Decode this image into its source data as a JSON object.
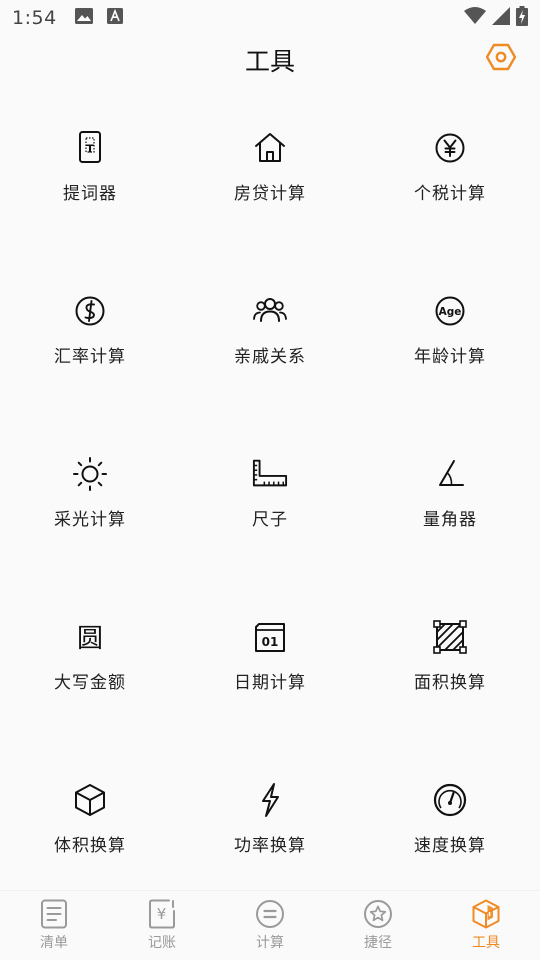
{
  "status_bar": {
    "time": "1:54",
    "left_icons": [
      "image-notification-icon",
      "font-notification-icon"
    ],
    "right_icons": [
      "wifi-icon",
      "cell-signal-icon",
      "battery-charging-icon"
    ]
  },
  "header": {
    "title": "工具",
    "settings_icon": "hexagon-settings-icon"
  },
  "tools": [
    {
      "label": "提词器",
      "icon": "teleprompter-icon"
    },
    {
      "label": "房贷计算",
      "icon": "house-icon"
    },
    {
      "label": "个税计算",
      "icon": "yen-circle-icon"
    },
    {
      "label": "汇率计算",
      "icon": "currency-exchange-icon"
    },
    {
      "label": "亲戚关系",
      "icon": "people-icon"
    },
    {
      "label": "年龄计算",
      "icon": "age-icon"
    },
    {
      "label": "采光计算",
      "icon": "sun-icon"
    },
    {
      "label": "尺子",
      "icon": "ruler-icon"
    },
    {
      "label": "量角器",
      "icon": "protractor-icon"
    },
    {
      "label": "大写金额",
      "icon": "yuan-character-icon"
    },
    {
      "label": "日期计算",
      "icon": "calendar-icon"
    },
    {
      "label": "面积换算",
      "icon": "area-icon"
    },
    {
      "label": "体积换算",
      "icon": "cube-icon"
    },
    {
      "label": "功率换算",
      "icon": "lightning-icon"
    },
    {
      "label": "速度换算",
      "icon": "speedometer-icon"
    }
  ],
  "tool_icon_texts": {
    "teleprompter": "T",
    "age": "Age",
    "yuan": "圆",
    "calendar": "01"
  },
  "bottom_nav": {
    "items": [
      {
        "label": "清单",
        "icon": "list-icon",
        "active": false
      },
      {
        "label": "记账",
        "icon": "ledger-yen-icon",
        "active": false
      },
      {
        "label": "计算",
        "icon": "calculator-equals-icon",
        "active": false
      },
      {
        "label": "捷径",
        "icon": "star-circle-icon",
        "active": false
      },
      {
        "label": "工具",
        "icon": "toolbox-icon",
        "active": true
      }
    ],
    "yen_glyph": "¥"
  },
  "colors": {
    "accent": "#f08a24",
    "inactive": "#9a9a9a",
    "text": "#222222",
    "background": "#fafafa"
  }
}
